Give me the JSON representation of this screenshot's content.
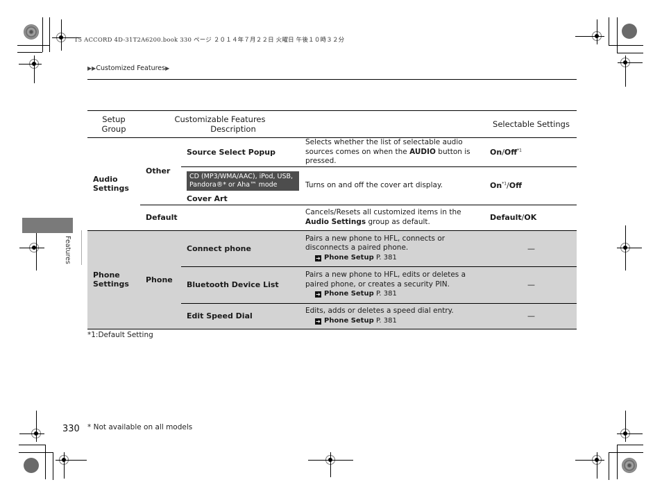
{
  "print_job_line": "15 ACCORD 4D-31T2A6200.book  330 ページ  ２０１４年７月２２日  火曜日  午後１０時３２分",
  "breadcrumb": {
    "prefix_icon": "double-triangle-right-icon",
    "label": "Customized Features",
    "suffix_icon": "triangle-right-icon"
  },
  "side_tab": {
    "label": "Features"
  },
  "table": {
    "headers": [
      "Setup Group",
      "Customizable Features",
      "Description",
      "Selectable Settings"
    ],
    "header_setup_line1": "Setup",
    "header_setup_line2": "Group",
    "audio": {
      "group": "Audio Settings",
      "group_line1": "Audio",
      "group_line2": "Settings",
      "other_label": "Other",
      "rows": [
        {
          "feature": "Source Select Popup",
          "desc_pre": "Selects whether the list of selectable audio sources comes on when the ",
          "desc_bold": "AUDIO",
          "desc_post": " button is pressed.",
          "setting_on": "On",
          "setting_sep": "/",
          "setting_off": "Off",
          "setting_note": "*1"
        },
        {
          "note": "CD (MP3/WMA/AAC), iPod, USB, Pandora®* or Aha™ mode",
          "feature": "Cover Art",
          "desc": "Turns on and off the cover art display.",
          "setting_on": "On",
          "setting_note": "*1",
          "setting_sep": "/",
          "setting_off": "Off"
        }
      ],
      "default_row": {
        "feature": "Default",
        "desc_pre": "Cancels/Resets all customized items in the ",
        "desc_bold": "Audio Settings",
        "desc_post": " group as default.",
        "setting_a": "Default",
        "setting_sep": "/",
        "setting_b": "OK"
      }
    },
    "phone": {
      "group": "Phone Settings",
      "group_line1": "Phone",
      "group_line2": "Settings",
      "sub": "Phone",
      "rows": [
        {
          "feature": "Connect phone",
          "desc": "Pairs a new phone to HFL, connects or disconnects a paired phone.",
          "xref_bold": "Phone Setup",
          "xref_page": "P. 381",
          "setting": "—"
        },
        {
          "feature": "Bluetooth Device List",
          "desc": "Pairs a new phone to HFL, edits or deletes a paired phone, or creates a security PIN.",
          "xref_bold": "Phone Setup",
          "xref_page": "P. 381",
          "setting": "—"
        },
        {
          "feature": "Edit Speed Dial",
          "desc": "Edits, adds or deletes a speed dial entry.",
          "xref_bold": "Phone Setup",
          "xref_page": "P. 381",
          "setting": "—"
        }
      ]
    }
  },
  "footnote_default": "*1:Default Setting",
  "page_number": "330",
  "footnote_availability": "* Not available on all models",
  "colors": {
    "side_tab": "#7a7a7a",
    "phone_rows_bg": "#d3d3d3",
    "note_box": "#4d4d4d"
  }
}
